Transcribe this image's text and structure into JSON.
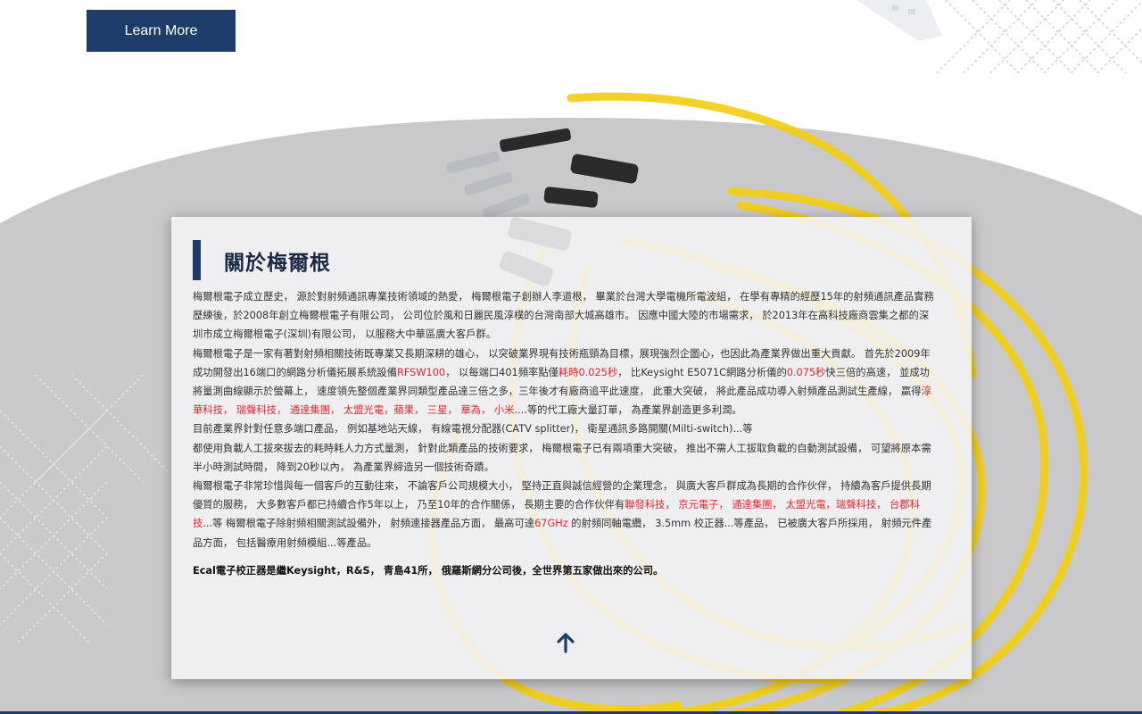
{
  "hero": {
    "learn_more_label": "Learn More"
  },
  "about": {
    "title": "關於梅爾根",
    "paragraphs": [
      [
        {
          "t": "梅爾根電子成立歷史， 源於對射頻通訊專業技術領域的熱愛， 梅爾根電子創辦人李道根， 畢業於台灣大學電機所電波組， 在學有專精的經歷15年的射頻通訊產品實務歷練後，於2008年創立梅爾根電子有限公司， 公司位於風和日麗民風淳樸的台灣南部大城高雄市。 因應中國大陸的市場需求， 於2013年在高科技廠商雲集之都的深圳市成立梅爾根電子(深圳)有限公司， 以服務大中華區廣大客戶群。",
          "hl": false
        }
      ],
      [
        {
          "t": "梅爾根電子是一家有著對射頻相關技術既專業又長期深耕的雄心， 以突破業界現有技術瓶頸為目標，展現強烈企圖心，也因此為產業界做出重大貢獻。 首先於2009年成功開發出16端口的網路分析儀拓展系統設備",
          "hl": false
        },
        {
          "t": "RFSW100",
          "hl": true
        },
        {
          "t": "， 以每端口401頻率點僅",
          "hl": false
        },
        {
          "t": "耗時0.025秒",
          "hl": true
        },
        {
          "t": "， 比Keysight E5071C網路分析儀的",
          "hl": false
        },
        {
          "t": "0.075秒",
          "hl": true
        },
        {
          "t": "快三倍的高速， 並成功將量測曲線顯示於螢幕上， 速度領先整個產業界同類型產品達三倍之多，三年後才有廠商追平此速度， 此重大突破， 將此產品成功導入射頻產品測試生產線， 贏得",
          "hl": false
        },
        {
          "t": "淳華科技， 瑞聲科技， 通達集團， 太盟光電，蘋果， 三星， 華為， 小米",
          "hl": true
        },
        {
          "t": "....等的代工廠大量訂單， 為產業界創造更多利潤。",
          "hl": false
        }
      ],
      [
        {
          "t": "目前產業界針對任意多端口產品， 例如基地站天線， 有線電視分配器(CATV splitter)， 衛星通訊多路開關(Milti-switch)...等",
          "hl": false
        }
      ],
      [
        {
          "t": "都使用負載人工拔來拔去的耗時耗人力方式量測， 針對此類產品的技術要求， 梅爾根電子已有兩項重大突破， 推出不需人工拔取負載的自動測試設備， 可望將原本需半小時測試時間， 降到20秒以內， 為產業界締造另一個技術奇蹟。",
          "hl": false
        }
      ],
      [
        {
          "t": "梅爾根電子非常珍惜與每一個客戶的互動往來， 不論客戶公司規模大小， 堅持正直與誠信經營的企業理念， 與廣大客戶群成為長期的合作伙伴， 持續為客戶提供長期優質的服務， 大多數客戶都已持續合作5年以上， 乃至10年的合作關係， 長期主要的合作伙伴有",
          "hl": false
        },
        {
          "t": "聯發科技， 京元電子， 通達集團， 太盟光電，瑞聲科技， 台郡科技",
          "hl": true
        },
        {
          "t": "...等 梅爾根電子除射頻相關測試設備外， 射頻連接器產品方面， 最高可達",
          "hl": false
        },
        {
          "t": "67GHz",
          "hl": true
        },
        {
          "t": " 的射頻同軸電纜， 3.5mm 校正器...等產品， 已被廣大客戶所採用， 射頻元件產品方面， 包括醫療用射頻模組...等產品。",
          "hl": false
        }
      ]
    ],
    "note": "Ecal電子校正器是繼Keysight，R&S， 青島41所， 俄羅斯網分公司後，全世界第五家做出來的公司。"
  },
  "colors": {
    "brand_navy": "#1d3c6a",
    "highlight_red": "#e8262b",
    "cable_yellow": "#f2cf1c"
  },
  "icons": {
    "scroll_top": "arrow-up-icon"
  }
}
